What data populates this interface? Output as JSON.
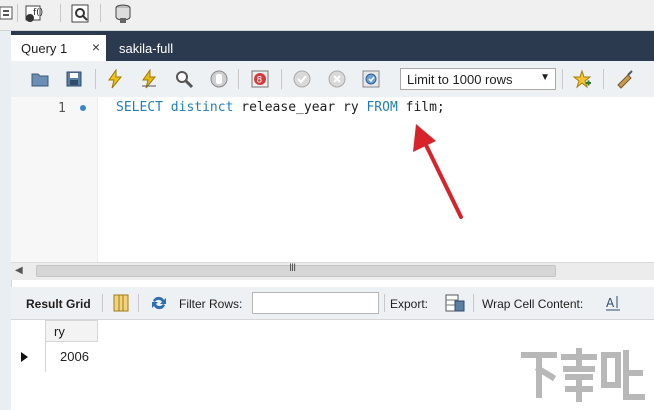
{
  "tabs": [
    {
      "label": "Query 1",
      "close": "×"
    },
    {
      "label": "sakila-full"
    }
  ],
  "sql_toolbar": {
    "limit_select": {
      "value": "Limit to 1000 rows",
      "arrow": "▼"
    }
  },
  "editor": {
    "line_number": "1",
    "code": {
      "kw1": "SELECT",
      "kw2": "distinct",
      "col": "release_year",
      "alias": "ry",
      "kw3": "FROM",
      "table": "film;"
    }
  },
  "scrollbar": {
    "left_arrow": "◀",
    "grip": "III"
  },
  "results_toolbar": {
    "result_grid": "Result Grid",
    "filter_rows": "Filter Rows:",
    "filter_value": "",
    "export": "Export:",
    "wrap": "Wrap Cell Content:"
  },
  "grid": {
    "columns": [
      "ry"
    ],
    "rows": [
      [
        "2006"
      ]
    ]
  },
  "watermark": {
    "text": "下载吧"
  },
  "colors": {
    "keyword": "#1f7fbf",
    "annotation_arrow": "#d8232a",
    "tabbar_bg": "#2b3a4e"
  }
}
